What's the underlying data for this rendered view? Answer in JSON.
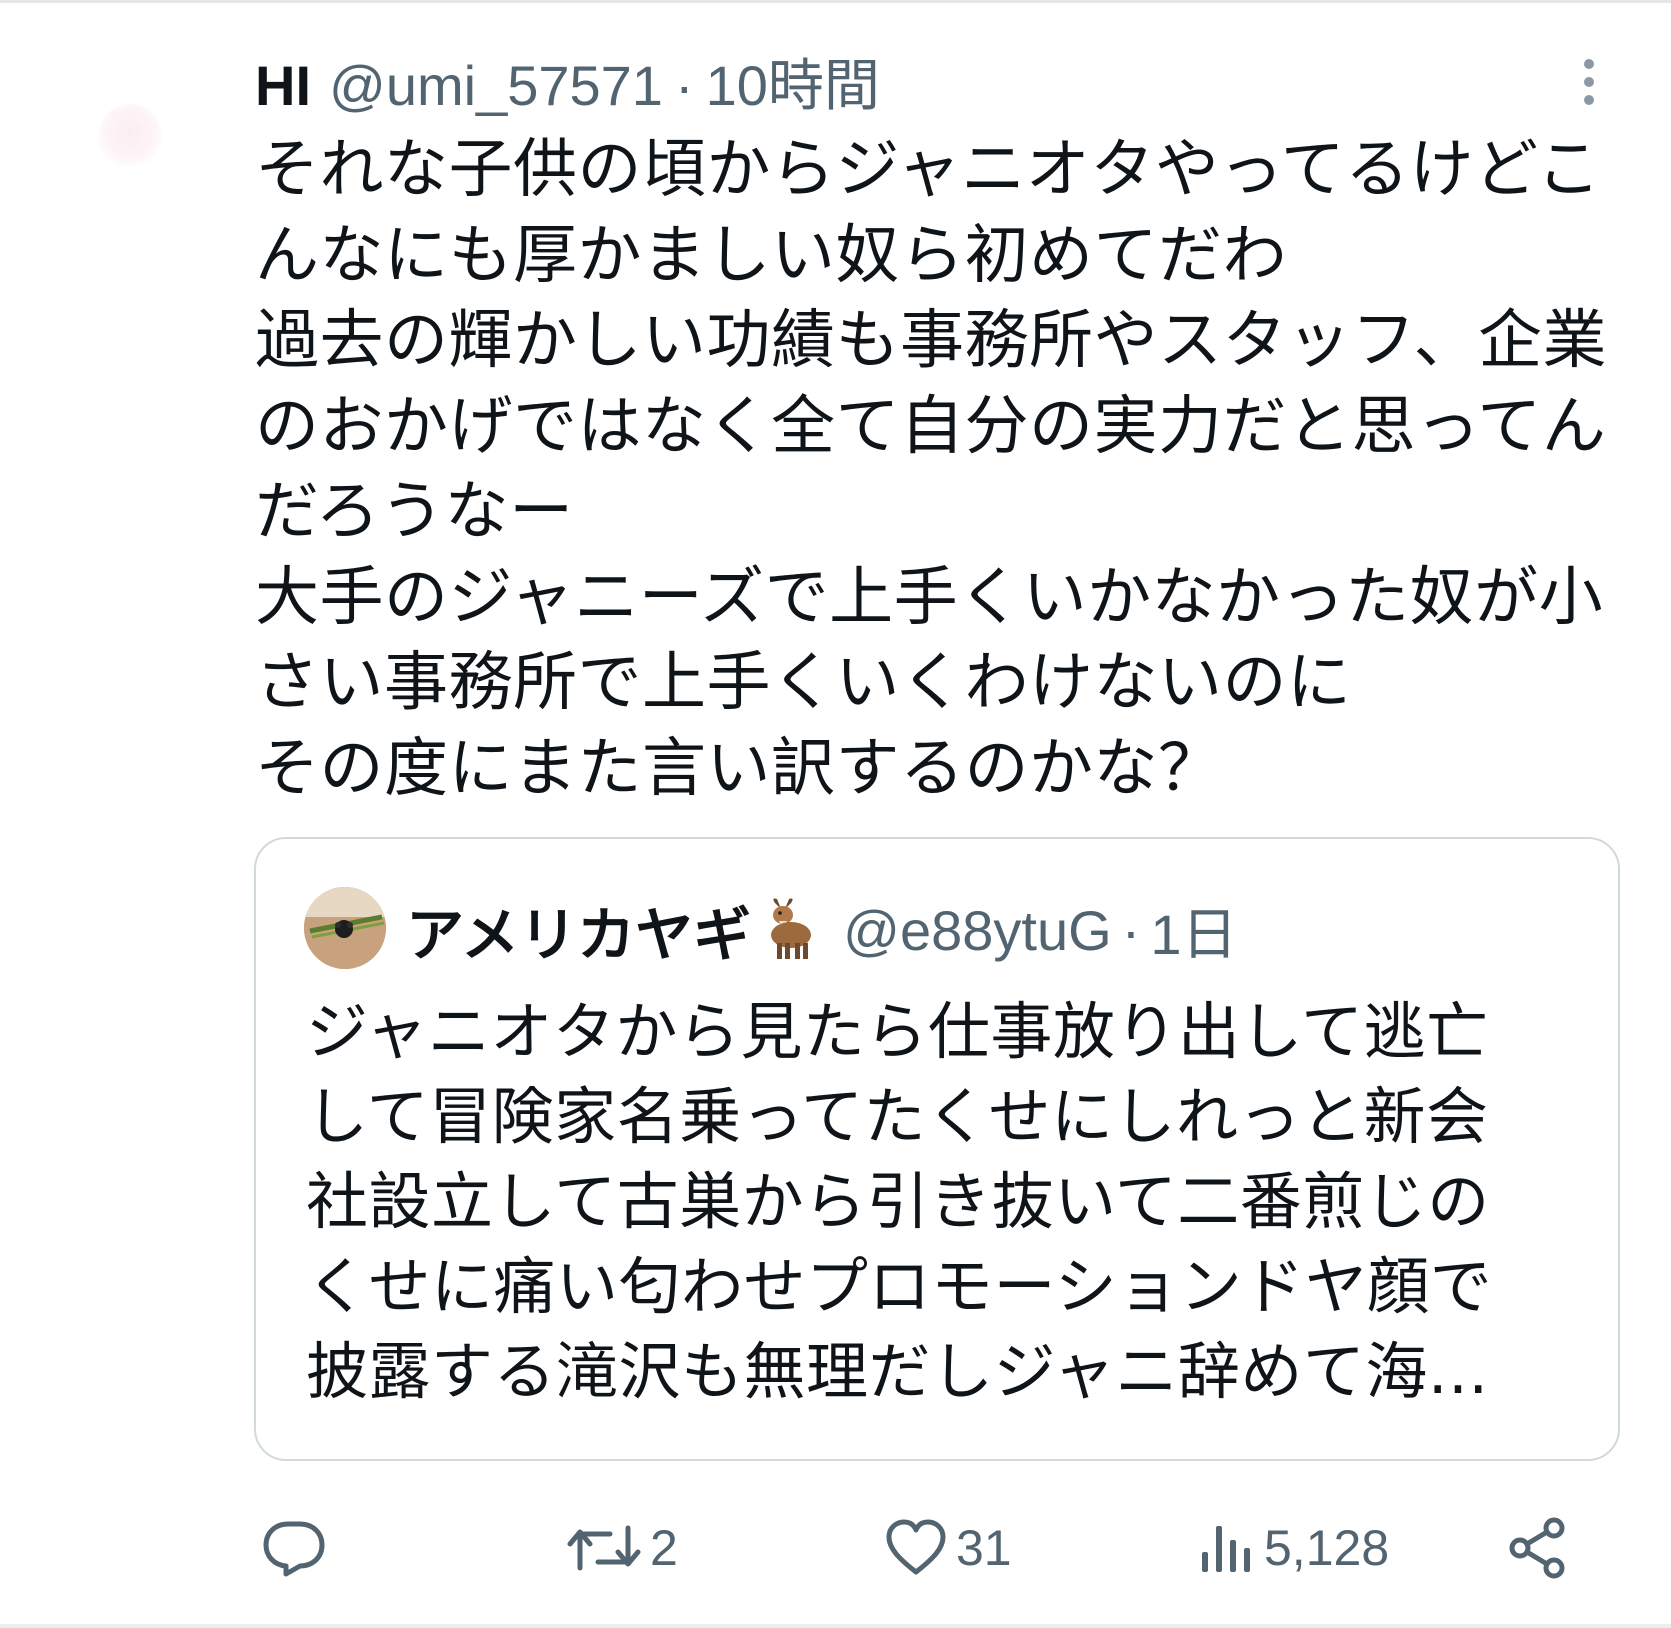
{
  "tweet": {
    "display_name": "HI",
    "handle": "@umi_57571",
    "separator": "·",
    "time": "10時間",
    "text": "それな子供の頃からジャニオタやってるけどこんなにも厚かましい奴ら初めてだわ\n過去の輝かしい功績も事務所やスタッフ、企業のおかげではなく全て自分の実力だと思ってんだろうなー\n大手のジャニーズで上手くいかなかった奴が小さい事務所で上手くいくわけないのに\nその度にまた言い訳するのかな？"
  },
  "quote": {
    "display_name": "アメリカヤギ",
    "handle": "@e88ytuG",
    "separator": "·",
    "time": "1日",
    "text": "ジャニオタから見たら仕事放り出して逃亡して冒険家名乗ってたくせにしれっと新会社設立して古巣から引き抜いて二番煎じのくせに痛い匂わせプロモーションドヤ顔で披露する滝沢も無理だしジャニ辞めて海..."
  },
  "actions": {
    "reply": {
      "icon": "reply-icon",
      "count": ""
    },
    "retweet": {
      "icon": "retweet-icon",
      "count": "2"
    },
    "like": {
      "icon": "heart-icon",
      "count": "31"
    },
    "views": {
      "icon": "views-icon",
      "count": "5,128"
    },
    "share": {
      "icon": "share-icon"
    }
  },
  "colors": {
    "text": "#0f1419",
    "secondary": "#536471",
    "border": "#cfd9de"
  }
}
